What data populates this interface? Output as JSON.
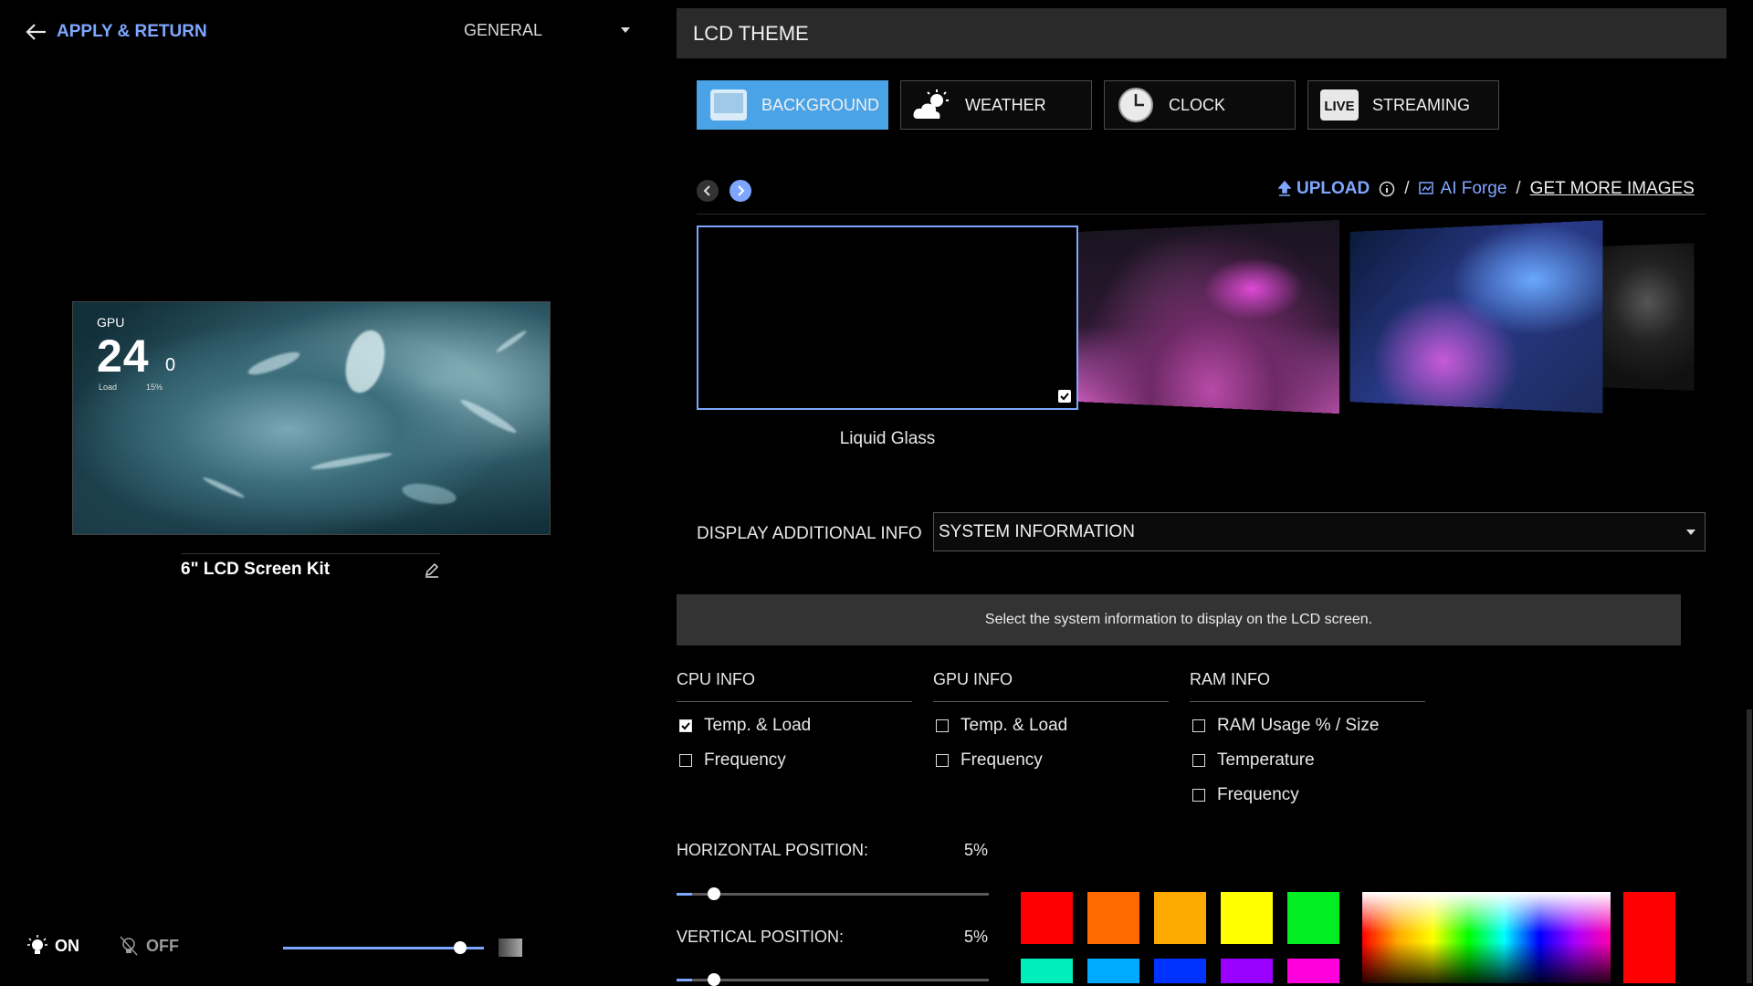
{
  "header": {
    "apply_return": "APPLY & RETURN",
    "mode_dropdown": "GENERAL"
  },
  "preview": {
    "gpu_label": "GPU",
    "temp_value": "24",
    "temp_unit": "0",
    "load_label": "Load",
    "load_value": "15%",
    "kit_name": "6\" LCD Screen Kit"
  },
  "power": {
    "on_label": "ON",
    "off_label": "OFF",
    "brightness_level": 0.88
  },
  "lcd_theme": {
    "title": "LCD THEME",
    "tabs": [
      {
        "label": "BACKGROUND",
        "icon": "image-icon",
        "active": true
      },
      {
        "label": "WEATHER",
        "icon": "weather-icon",
        "active": false
      },
      {
        "label": "CLOCK",
        "icon": "clock-icon",
        "active": false
      },
      {
        "label": "STREAMING",
        "icon": "live-icon",
        "badge": "LIVE",
        "active": false
      }
    ],
    "upload_label": "UPLOAD",
    "ai_forge_label": "AI Forge",
    "get_more_label": "GET MORE IMAGES",
    "slash": "/",
    "selected_background": "Liquid Glass",
    "display_additional_info_label": "DISPLAY ADDITIONAL INFO",
    "display_additional_info_value": "SYSTEM INFORMATION",
    "hint": "Select the system information to display on the LCD screen."
  },
  "info_columns": [
    {
      "title": "CPU INFO",
      "items": [
        {
          "label": "Temp. & Load",
          "checked": true
        },
        {
          "label": "Frequency",
          "checked": false
        }
      ]
    },
    {
      "title": "GPU INFO",
      "items": [
        {
          "label": "Temp. & Load",
          "checked": false
        },
        {
          "label": "Frequency",
          "checked": false
        }
      ]
    },
    {
      "title": "RAM INFO",
      "items": [
        {
          "label": "RAM Usage % / Size",
          "checked": false
        },
        {
          "label": "Temperature",
          "checked": false
        },
        {
          "label": "Frequency",
          "checked": false
        }
      ]
    }
  ],
  "position": {
    "horizontal_label": "HORIZONTAL POSITION:",
    "horizontal_value": "5%",
    "horizontal_level": 0.05,
    "vertical_label": "VERTICAL POSITION:",
    "vertical_value": "5%",
    "vertical_level": 0.05
  },
  "colors": {
    "accent": "#7fa6ff",
    "tab_active": "#4aa3e6",
    "swatches_row1": [
      "#ff0000",
      "#ff6a00",
      "#ffaa00",
      "#ffff00",
      "#00ee22"
    ],
    "swatches_row2": [
      "#00eebb",
      "#00aaff",
      "#0033ff",
      "#9900ff",
      "#ff00dd"
    ],
    "current": "#ff0000"
  }
}
